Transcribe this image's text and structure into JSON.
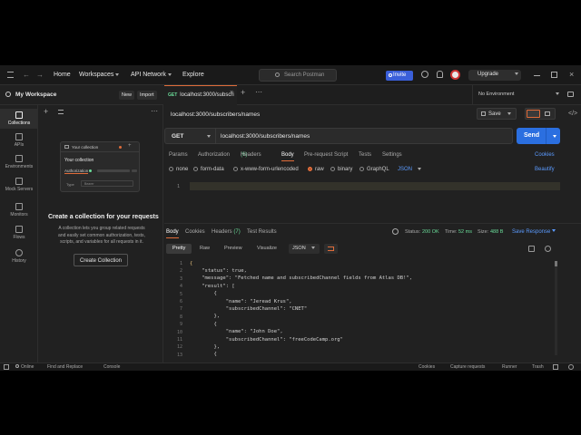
{
  "topbar": {
    "home": "Home",
    "workspaces": "Workspaces",
    "api_network": "API Network",
    "explore": "Explore",
    "search_placeholder": "Search Postman",
    "invite": "Invite",
    "upgrade": "Upgrade"
  },
  "workspace": {
    "name": "My Workspace",
    "new_btn": "New",
    "import_btn": "Import"
  },
  "rail": [
    {
      "label": "Collections",
      "icon": "collections-icon"
    },
    {
      "label": "APIs",
      "icon": "apis-icon"
    },
    {
      "label": "Environments",
      "icon": "environments-icon"
    },
    {
      "label": "Mock Servers",
      "icon": "mock-servers-icon"
    },
    {
      "label": "Monitors",
      "icon": "monitors-icon"
    },
    {
      "label": "Flows",
      "icon": "flows-icon"
    },
    {
      "label": "History",
      "icon": "history-icon"
    }
  ],
  "mock_card": {
    "header": "Your collection",
    "title": "Your collection",
    "authorization": "Authorization",
    "type_label": "Type",
    "type_value": "Bearer"
  },
  "empty_state": {
    "heading": "Create a collection for your requests",
    "line1": "A collection lets you group related requests",
    "line2": "and easily set common authorization, tests,",
    "line3": "scripts, and variables for all requests in it.",
    "button": "Create Collection"
  },
  "tab": {
    "method": "GET",
    "title": "localhost:3000/subscri"
  },
  "environment": "No Environment",
  "request": {
    "name": "localhost:3000/subscribers/names",
    "save": "Save",
    "method": "GET",
    "url": "localhost:3000/subscribers/names",
    "send": "Send",
    "cookies": "Cookies",
    "beautify": "Beautify"
  },
  "req_tabs": [
    {
      "label": "Params"
    },
    {
      "label": "Authorization"
    },
    {
      "label": "Headers"
    },
    {
      "label": "Body"
    },
    {
      "label": "Pre-request Script"
    },
    {
      "label": "Tests"
    },
    {
      "label": "Settings"
    }
  ],
  "headers_count": "(6)",
  "body_types": [
    "none",
    "form-data",
    "x-www-form-urlencoded",
    "raw",
    "binary",
    "GraphQL"
  ],
  "body_format": "JSON",
  "editor_line": "1",
  "response": {
    "tabs": [
      "Body",
      "Cookies",
      "Headers",
      "Test Results"
    ],
    "headers_count": "(7)",
    "status_label": "Status:",
    "status_value": "200 OK",
    "time_label": "Time:",
    "time_value": "52 ms",
    "size_label": "Size:",
    "size_value": "488 B",
    "save_response": "Save Response",
    "views": [
      "Pretty",
      "Raw",
      "Preview",
      "Visualize"
    ],
    "format": "JSON"
  },
  "code_lines": [
    {
      "n": "1",
      "t": "{"
    },
    {
      "n": "2",
      "t": "    \"status\": true,"
    },
    {
      "n": "3",
      "t": "    \"message\": \"Fetched name and subscribedChannel fields from Atlas DB!\","
    },
    {
      "n": "4",
      "t": "    \"result\": ["
    },
    {
      "n": "5",
      "t": "        {"
    },
    {
      "n": "6",
      "t": "            \"name\": \"Jeread Krus\","
    },
    {
      "n": "7",
      "t": "            \"subscribedChannel\": \"CNET\""
    },
    {
      "n": "8",
      "t": "        },"
    },
    {
      "n": "9",
      "t": "        {"
    },
    {
      "n": "10",
      "t": "            \"name\": \"John Doe\","
    },
    {
      "n": "11",
      "t": "            \"subscribedChannel\": \"freeCodeCamp.org\""
    },
    {
      "n": "12",
      "t": "        },"
    },
    {
      "n": "13",
      "t": "        {"
    }
  ],
  "statusbar": {
    "online": "Online",
    "find_replace": "Find and Replace",
    "console": "Console",
    "cookies": "Cookies",
    "capture": "Capture requests",
    "runner": "Runner",
    "trash": "Trash"
  },
  "colors": {
    "accent": "#e06c3a",
    "send_blue": "#2b6fe0",
    "status_green": "#6bdd9a"
  }
}
